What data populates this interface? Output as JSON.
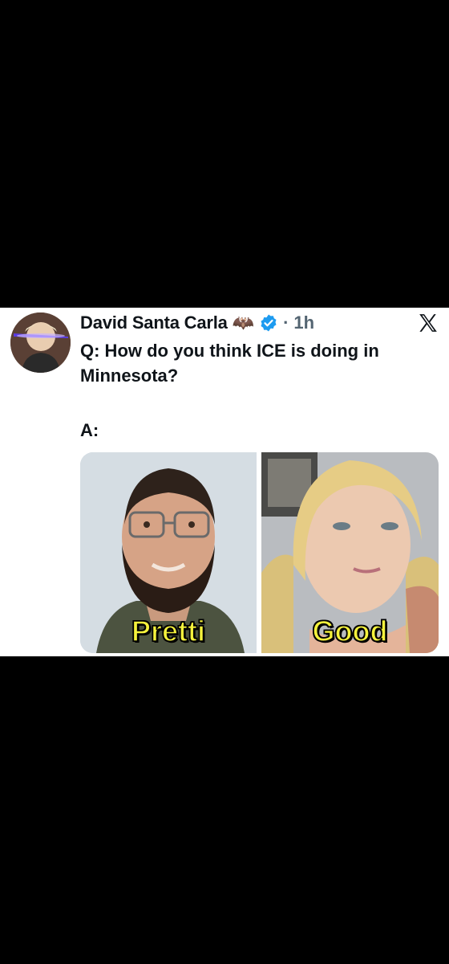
{
  "tweet": {
    "display_name": "David Santa Carla",
    "name_emoji": "🦇",
    "verified_icon": "verified-badge-icon",
    "separator": "·",
    "timestamp": "1h",
    "platform_logo": "x-logo-icon",
    "question": "Q: How do you think ICE is doing in Minnesota?",
    "answer": "A:",
    "media": [
      {
        "caption": "Pretti",
        "subject": "bearded-man-with-glasses"
      },
      {
        "caption": "Good",
        "subject": "blonde-woman"
      }
    ]
  },
  "colors": {
    "background": "#000000",
    "card": "#ffffff",
    "text": "#0f1419",
    "muted": "#536471",
    "verified": "#1d9bf0",
    "caption": "#f5f23c"
  }
}
